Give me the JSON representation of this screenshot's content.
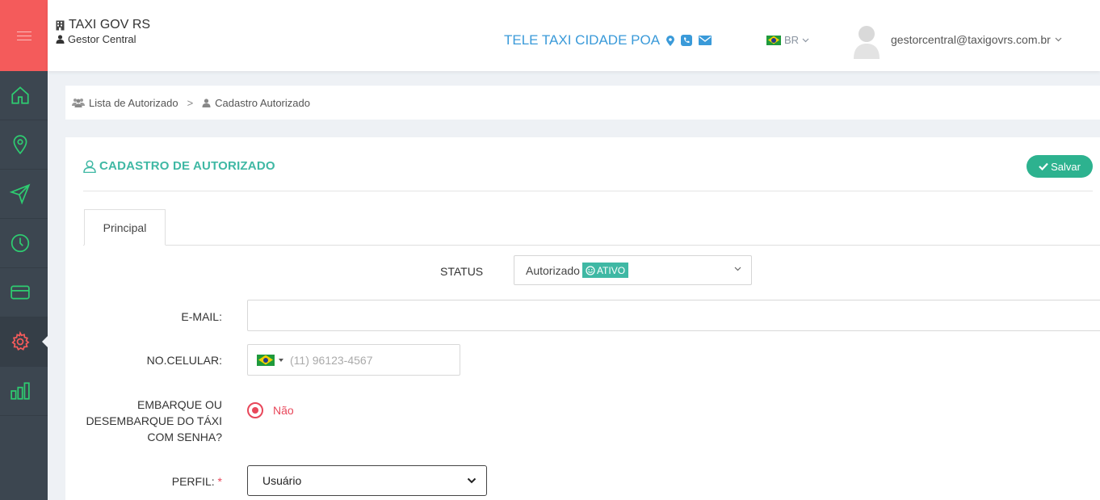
{
  "header": {
    "brand_title": "TAXI GOV RS",
    "brand_sub": "Gestor Central",
    "company": "TELE TAXI CIDADE POA",
    "language": "BR",
    "user_email": "gestorcentral@taxigovrs.com.br"
  },
  "sidebar": {
    "items": [
      {
        "icon": "home-icon"
      },
      {
        "icon": "map-pin-icon"
      },
      {
        "icon": "send-icon"
      },
      {
        "icon": "clock-icon"
      },
      {
        "icon": "credit-card-icon"
      },
      {
        "icon": "gear-icon",
        "active": true
      },
      {
        "icon": "bar-chart-icon"
      }
    ]
  },
  "breadcrumb": {
    "item1": "Lista de Autorizado",
    "item2": "Cadastro Autorizado"
  },
  "page": {
    "title": "CADASTRO DE AUTORIZADO",
    "save_label": "Salvar",
    "tab": "Principal"
  },
  "form": {
    "status_label": "STATUS",
    "status_value": "Autorizado",
    "status_badge": "ATIVO",
    "email_label": "E-MAIL:",
    "email_value": "",
    "phone_label": "NO.CELULAR:",
    "phone_placeholder": "(11) 96123-4567",
    "embarque_label_line1": "EMBARQUE OU",
    "embarque_label_line2": "DESEMBARQUE DO TÁXI",
    "embarque_label_line3": "COM SENHA?",
    "embarque_value": "Não",
    "perfil_label": "PERFIL:",
    "perfil_required": "*",
    "perfil_value": "Usuário"
  },
  "colors": {
    "accent": "#3fb8a4",
    "save": "#2db28f",
    "company": "#3a9ad9",
    "menu": "#f45b5b",
    "sidebar_icons": "#2ecc71",
    "active_icon": "#f45b5b",
    "radio": "#e8475a"
  }
}
